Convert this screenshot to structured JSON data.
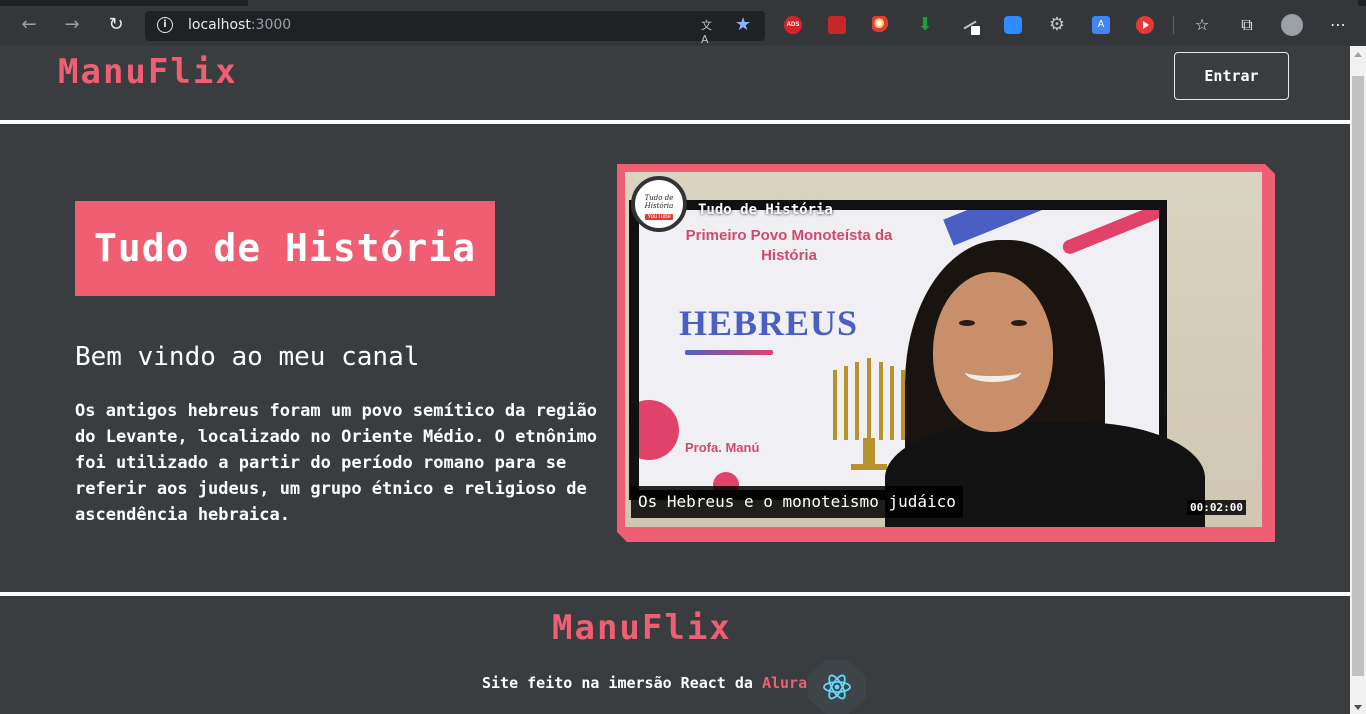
{
  "browser": {
    "url_host": "localhost",
    "url_port": ":3000",
    "extensions": [
      "adblock-icon",
      "extension-red-icon",
      "extension-color-icon",
      "download-arrow-icon",
      "pen-icon",
      "zoom-icon",
      "gear-icon",
      "translate-icon",
      "youtube-icon"
    ],
    "adblock_label": "ADS"
  },
  "header": {
    "logo": "ManuFlix",
    "login_button": "Entrar"
  },
  "banner": {
    "category": "Tudo de História",
    "welcome": "Bem vindo ao meu canal",
    "description": "Os antigos hebreus foram um povo semítico da região do Levante, localizado no Oriente Médio. O etnônimo foi utilizado a partir do período romano para se referir aos judeus, um grupo étnico e religioso de ascendência hebraica."
  },
  "video": {
    "channel_name": "Tudo de História",
    "channel_avatar_text": "Tudo de História",
    "channel_avatar_badge": "YouTube",
    "screen_title": "Primeiro Povo Monoteísta da História",
    "screen_heading": "HEBREUS",
    "screen_presenter": "Profa. Manú",
    "caption": "Os Hebreus e o monoteismo judáico",
    "duration": "00:02:00"
  },
  "footer": {
    "logo": "ManuFlix",
    "text": "Site feito na imersão React da ",
    "brand": "Alura."
  },
  "colors": {
    "accent": "#f05e73",
    "background": "#393d40",
    "react": "#61dafb"
  }
}
